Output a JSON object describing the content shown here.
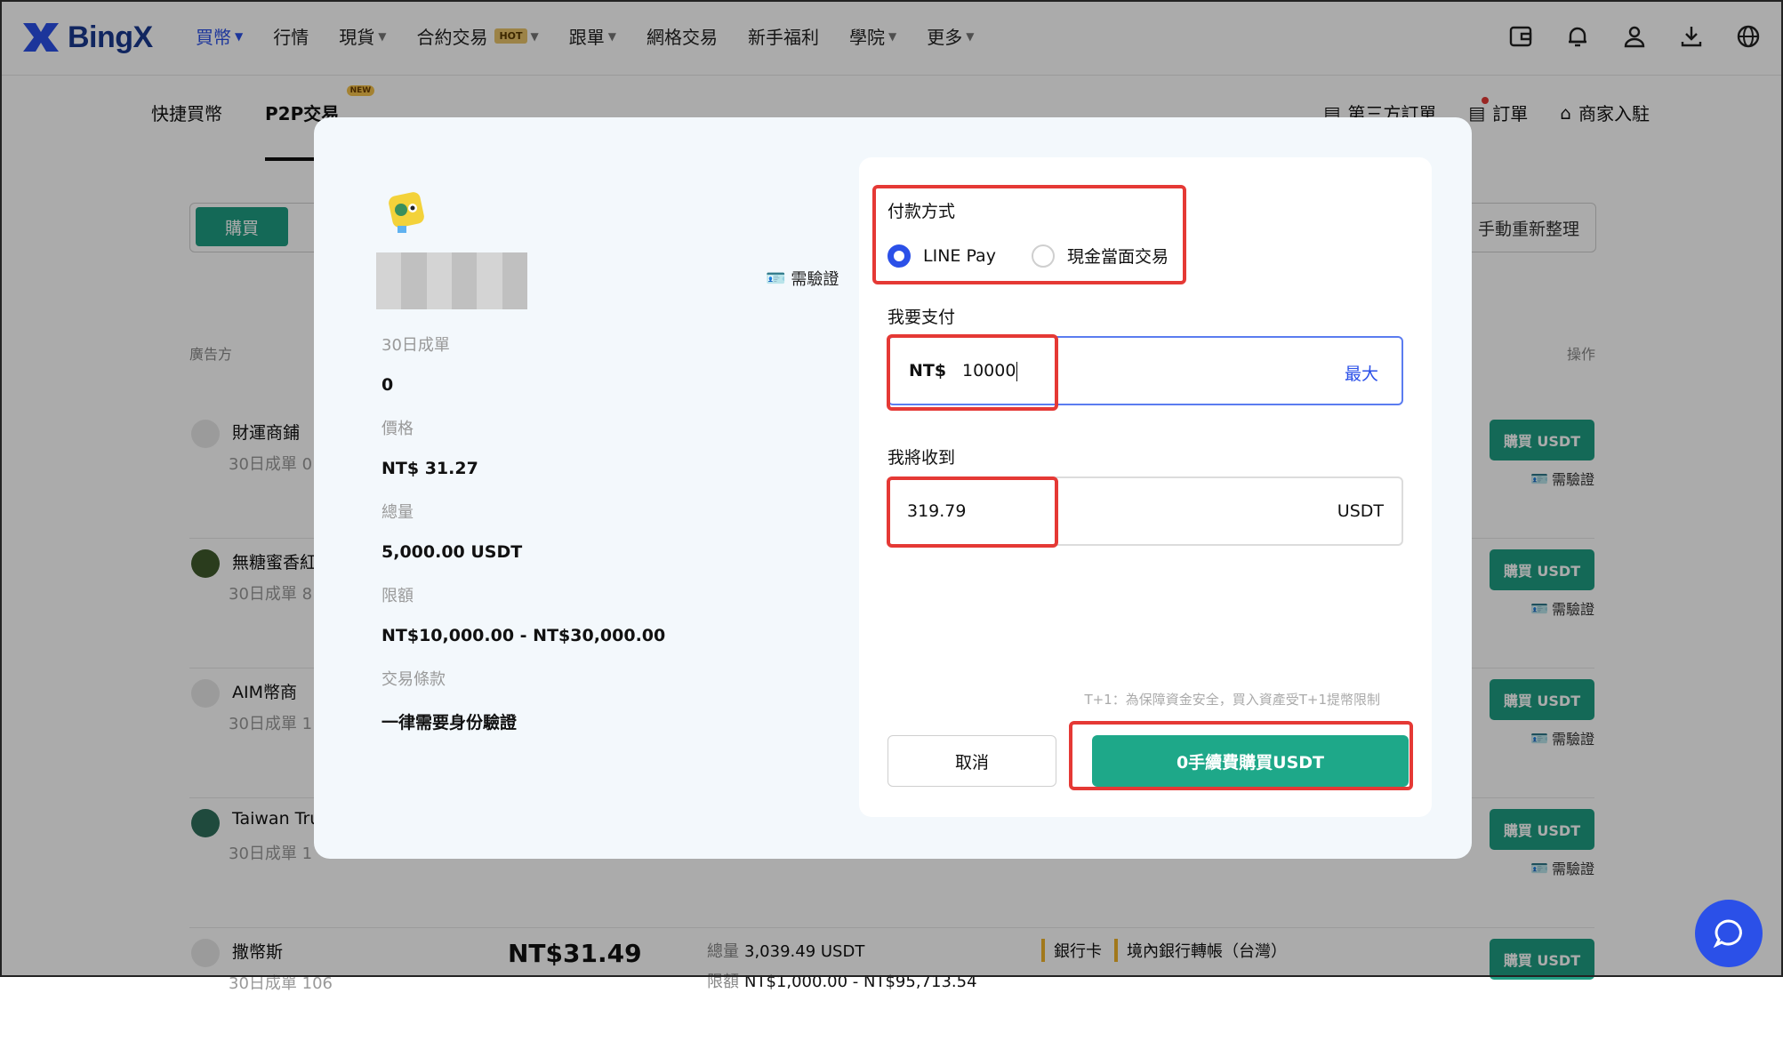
{
  "brand": {
    "name": "BingX",
    "accent": "#2b50e8",
    "buy_green": "#1f9d82"
  },
  "nav": {
    "items": [
      {
        "label": "買幣",
        "caret": true,
        "active": true
      },
      {
        "label": "行情"
      },
      {
        "label": "現貨",
        "caret": true
      },
      {
        "label": "合約交易",
        "badge": "HOT",
        "caret": true
      },
      {
        "label": "跟單",
        "caret": true
      },
      {
        "label": "網格交易"
      },
      {
        "label": "新手福利"
      },
      {
        "label": "學院",
        "caret": true
      },
      {
        "label": "更多",
        "caret": true
      }
    ],
    "icons": [
      "wallet-icon",
      "bell-icon",
      "user-icon",
      "download-icon",
      "globe-icon"
    ]
  },
  "subnav": {
    "quick": "快捷買幣",
    "p2p": "P2P交易",
    "p2p_badge": "NEW",
    "third_party": "第三方訂單",
    "orders": "訂單",
    "merchant": "商家入駐"
  },
  "filter": {
    "buy_tab": "購買",
    "refresh": "手動重新整理"
  },
  "table": {
    "col_advertiser": "廣告方",
    "col_action": "操作"
  },
  "rows": [
    {
      "name": "財運商鋪",
      "stat": "30日成單 0",
      "buy": "購買 USDT",
      "kyc": "需驗證"
    },
    {
      "name": "無糖蜜香紅",
      "stat": "30日成單 8",
      "buy": "購買 USDT",
      "kyc": "需驗證"
    },
    {
      "name": "AIM幣商",
      "stat": "30日成單 1",
      "buy": "購買 USDT",
      "kyc": "需驗證"
    },
    {
      "name": "Taiwan Tru",
      "stat": "30日成單 1",
      "buy": "購買 USDT",
      "kyc": "需驗證"
    },
    {
      "name": "撒幣斯",
      "stat": "30日成單 106",
      "price": "NT$31.49",
      "qty_label": "總量",
      "qty": "3,039.49 USDT",
      "limit_label": "限額",
      "limit": "NT$1,000.00 - NT$95,713.54",
      "pay1": "銀行卡",
      "pay2": "境內銀行轉帳（台灣）",
      "buy": "購買 USDT"
    }
  ],
  "modal": {
    "kyc": "需驗證",
    "orders_30d_label": "30日成單",
    "orders_30d": "0",
    "price_label": "價格",
    "price": "NT$ 31.27",
    "total_label": "總量",
    "total": "5,000.00 USDT",
    "limit_label": "限額",
    "limit": "NT$10,000.00 - NT$30,000.00",
    "terms_label": "交易條款",
    "terms": "一律需要身份驗證",
    "payment_label": "付款方式",
    "payment_options": [
      "LINE Pay",
      "現金當面交易"
    ],
    "payment_selected": "LINE Pay",
    "pay_label": "我要支付",
    "pay_currency": "NT$",
    "pay_amount": "10000",
    "max": "最大",
    "receive_label": "我將收到",
    "receive_amount": "319.79",
    "receive_unit": "USDT",
    "note": "T+1：為保障資金安全，買入資產受T+1提幣限制",
    "cancel": "取消",
    "confirm": "0手續費購買USDT"
  }
}
